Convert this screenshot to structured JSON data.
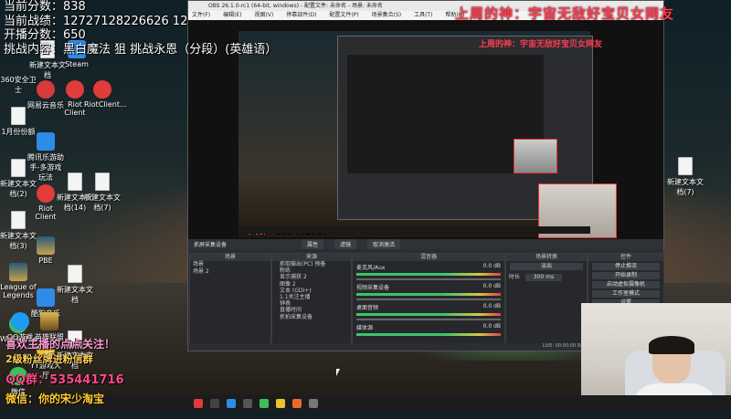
{
  "overlay": {
    "current_score": "当前分数：838",
    "current_record": "当前战绩：12727128226626 12",
    "start_score": "开播分数：650",
    "challenge": "挑战内容：黑白魔法 狙 挑战永恩（分段）(英雄语）",
    "title_red": "上周的神：宇宙无敌好宝贝女网友"
  },
  "desktop_icons": [
    {
      "label": "360安全卫士",
      "icon": "360-icon"
    },
    {
      "label": "新建文本文档",
      "icon": "doc-icon"
    },
    {
      "label": "Steam",
      "icon": "steam-icon"
    },
    {
      "label": "1月份份额",
      "icon": "doc-icon"
    },
    {
      "label": "网易云音乐",
      "icon": "netease-music-icon"
    },
    {
      "label": "Riot Client",
      "icon": "riot-icon"
    },
    {
      "label": "RiotClient...",
      "icon": "riot-icon"
    },
    {
      "label": "新建文本文档(2)",
      "icon": "doc-icon"
    },
    {
      "label": "腾讯乐游助手-多游戏玩法",
      "icon": "tencent-icon"
    },
    {
      "label": "新建文本文档(3)",
      "icon": "doc-icon"
    },
    {
      "label": "Riot Client",
      "icon": "riot-icon"
    },
    {
      "label": "新建文本文档(14)",
      "icon": "doc-icon"
    },
    {
      "label": "新建文本文档(7)",
      "icon": "doc-icon"
    },
    {
      "label": "League of Legends",
      "icon": "lol-icon"
    },
    {
      "label": "PBE",
      "icon": "pbe-icon"
    },
    {
      "label": "WeChatSe...",
      "icon": "wechat-icon"
    },
    {
      "label": "酷狗音乐",
      "icon": "kugou-icon"
    },
    {
      "label": "新建文本文档",
      "icon": "doc-icon"
    },
    {
      "label": "微信",
      "icon": "wechat-icon"
    },
    {
      "label": "YY游戏大厅",
      "icon": "yy-icon"
    },
    {
      "label": "QQ游戏",
      "icon": "qq-icon"
    },
    {
      "label": "英雄联盟WeGame版",
      "icon": "lol-icon"
    },
    {
      "label": "新建文本文档",
      "icon": "doc-icon"
    },
    {
      "label": "新建文本文档(7)",
      "icon": "doc-icon"
    }
  ],
  "obs": {
    "title": "OBS 26.1.0-rc1 (64-bit, windows) - 配置文件: 未命名 - 场景: 未命名",
    "menu": [
      "文件(F)",
      "编辑(E)",
      "视图(V)",
      "停靠部件(D)",
      "配置文件(P)",
      "场景集合(S)",
      "工具(T)",
      "帮助(H)"
    ],
    "toolbar": {
      "source_label": "抓屏采集设备",
      "props": "属性",
      "filters": "滤镜",
      "cancel_refresh": "取消激活"
    },
    "panels": {
      "scenes": "场景",
      "sources": "来源",
      "mixer": "混音器",
      "transitions": "场景转换",
      "controls": "控件"
    },
    "scenes": [
      "场景",
      "场景 2"
    ],
    "sources": [
      "抓取输出(PC) 预备",
      "粉练",
      "显示捕获 2",
      "图像 2",
      "文本 (GDI+)",
      "1.1关注主播",
      "钟表",
      "直播时间",
      "抓拍采集设备"
    ],
    "mixer": [
      {
        "name": "麦克风/Aux",
        "value": "0.0 dB"
      },
      {
        "name": "视频采集设备",
        "value": "0.0 dB"
      },
      {
        "name": "桌面音频",
        "value": "0.0 dB"
      },
      {
        "name": "媒体源",
        "value": "0.0 dB"
      }
    ],
    "transition": {
      "type": "淡出",
      "duration_label": "时长",
      "duration": "300 ms"
    },
    "controls": [
      "停止推流",
      "开始录制",
      "启动虚拟摄像机",
      "工作室模式",
      "设置",
      "退出"
    ],
    "status": "LIVE: 00:00:00   REC: 00:00:00   CPU: 5.2%, 60.00 fps"
  },
  "banner": {
    "line1": "喜欢主播的点点关注！",
    "line2": "2级粉丝牌进粉信群",
    "line3": "QQ群：535441716",
    "line4": "微信：你的宋少淘宝"
  },
  "inner_qq": "QQ群：535441716",
  "taskbar": {
    "time": "",
    "date": ""
  }
}
